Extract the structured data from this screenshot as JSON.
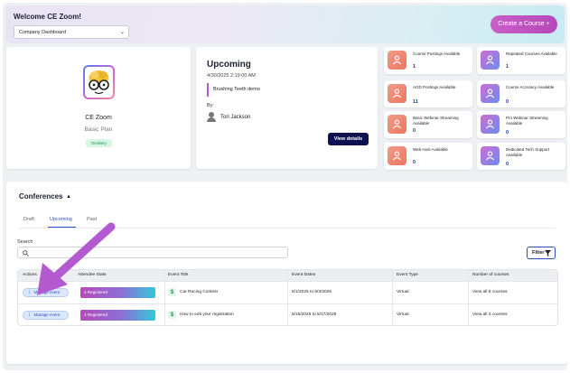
{
  "header": {
    "welcome": "Welcome CE Zoom!",
    "dashboard_select": "Company Dashboard",
    "create_button": "Create a Course +"
  },
  "profile": {
    "company": "CE Zoom",
    "plan": "Basic Plan",
    "badge": "Dentistry"
  },
  "upcoming": {
    "title": "Upcoming",
    "datetime": "4/30/2025 2:19:00 AM",
    "event": "Brushing Teeth demo",
    "by_label": "By:",
    "person": "Tori Jackson",
    "view_button": "View details"
  },
  "stats": [
    {
      "label": "Course Postings Available",
      "value": "1",
      "icon": "people-icon",
      "tone": "warm"
    },
    {
      "label": "Repeated Courses Available",
      "value": "1",
      "icon": "people-icon",
      "tone": "cool"
    },
    {
      "label": "AGD Postings Available",
      "value": "11",
      "icon": "people-icon",
      "tone": "warm"
    },
    {
      "label": "Course Accuracy Available",
      "value": "0",
      "icon": "people-icon",
      "tone": "cool"
    },
    {
      "label": "Basic Webinar Streaming Available",
      "value": "0",
      "icon": "people-icon",
      "tone": "warm"
    },
    {
      "label": "Pro Webinar Streaming Available",
      "value": "0",
      "icon": "people-icon",
      "tone": "cool"
    },
    {
      "label": "Web Host Available",
      "value": "0",
      "icon": "people-icon",
      "tone": "warm"
    },
    {
      "label": "Dedicated Tech Support Available",
      "value": "0",
      "icon": "people-icon",
      "tone": "cool"
    }
  ],
  "conferences": {
    "title": "Conferences",
    "tabs": [
      "Draft",
      "Upcoming",
      "Past"
    ],
    "active_tab": "Upcoming",
    "search_label": "Search",
    "search_placeholder": "",
    "filter_button": "Filter",
    "columns": [
      "Actions",
      "Attendee Stats",
      "Event Title",
      "Event Dates",
      "Event Type",
      "Number of courses"
    ],
    "rows": [
      {
        "action": "Manage event",
        "registered": "4 Registered",
        "title": "Car Racing Contest",
        "dates": "6/1/2025 to 6/3/2025",
        "type": "Virtual",
        "courses": "View all 8 courses"
      },
      {
        "action": "Manage event",
        "registered": "1 Registered",
        "title": "How to edit your registration",
        "dates": "5/15/2025 to 5/17/2025",
        "type": "Virtual",
        "courses": "View all 3 courses"
      }
    ]
  },
  "colors": {
    "accent_blue": "#2a4fc4",
    "navy_button": "#0e1250",
    "magenta": "#c95fc7",
    "annotation_arrow": "#b45ad1"
  }
}
